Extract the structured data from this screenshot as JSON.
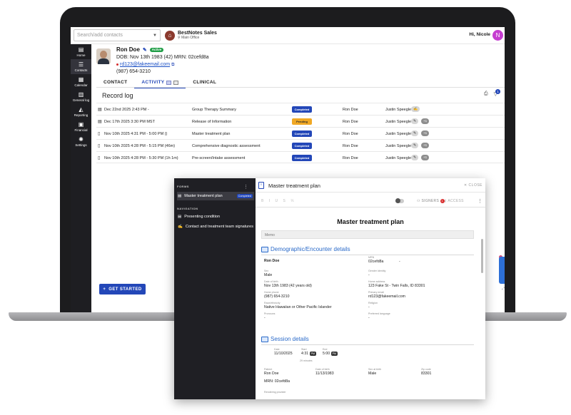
{
  "topbar": {
    "search_placeholder": "Search/add contacts",
    "org_name": "BestNotes Sales",
    "org_location": "Main Office",
    "greeting": "Hi, Nicole",
    "user_initial": "N"
  },
  "nav": {
    "items": [
      {
        "icon": "home-icon",
        "glyph": "▤",
        "label": "Home"
      },
      {
        "icon": "contacts-icon",
        "glyph": "☰",
        "label": "Contacts"
      },
      {
        "icon": "calendar-icon",
        "glyph": "▦",
        "label": "Calendar"
      },
      {
        "icon": "general-log-icon",
        "glyph": "▥",
        "label": "General log"
      },
      {
        "icon": "reporting-icon",
        "glyph": "◭",
        "label": "Reporting"
      },
      {
        "icon": "financial-icon",
        "glyph": "▣",
        "label": "Financial"
      },
      {
        "icon": "settings-icon",
        "glyph": "✺",
        "label": "Settings"
      }
    ]
  },
  "contact": {
    "name": "Ron Doe",
    "status": "Active",
    "dob_line": "DOB: Nov 13th 1983 (42)  MRN: 02cefd8a",
    "email": "rd123@fakeemail.com",
    "phone": "(987) 654-3210"
  },
  "tabs": [
    "CONTACT",
    "ACTIVITY",
    "CLINICAL"
  ],
  "record_log": {
    "title": "Record log",
    "filter_count": "1",
    "rows": [
      {
        "date": "Dec 22nd 2025 2:43 PM -",
        "title": "Group Therapy Summary",
        "status": "Completed",
        "client": "Ron Doe",
        "staff": "Justin Speegle",
        "chip2": ""
      },
      {
        "date": "Dec 17th 2025 3:30 PM MST",
        "title": "Release of Information",
        "status": "Pending",
        "client": "Ron Doe",
        "staff": "Justin Speegle",
        "chip2": "+1"
      },
      {
        "date": "Nov 10th 2025 4:31 PM - 5:00 PM ()",
        "title": "Master treatment plan",
        "status": "Completed",
        "client": "Ron Doe",
        "staff": "Justin Speegle",
        "chip2": "+1"
      },
      {
        "date": "Nov 10th 2025 4:28 PM - 5:15 PM (46m)",
        "title": "Comprehensive diagnostic assessment",
        "status": "Completed",
        "client": "Ron Doe",
        "staff": "Justin Speegle",
        "chip2": "+1"
      },
      {
        "date": "Nov 10th 2025 4:28 PM - 5:30 PM (1h 1m)",
        "title": "Pre-screen/Intake assessment",
        "status": "Completed",
        "client": "Ron Doe",
        "staff": "Justin Speegle",
        "chip2": "+1"
      }
    ]
  },
  "get_started": "GET STARTED",
  "popup": {
    "forms_header": "FORMS",
    "form_item": "Master treatment plan",
    "form_status": "Completed",
    "navigation_header": "NAVIGATION",
    "nav_items": [
      "Presenting condition",
      "Contact and treatment team signatures"
    ],
    "title": "Master treatment plan",
    "close": "CLOSE",
    "format_tools": "B I U S ⅓",
    "signers": "SIGNERS",
    "signers_count": "1",
    "access": "ACCESS",
    "doc_title": "Master treatment plan",
    "memo": "Memo",
    "demo_section": "Demographic/Encounter details",
    "demo": {
      "name": "Ron Doe",
      "mrn_label": "MRN",
      "mrn": "02cefd8a",
      "mrn_extra": "-",
      "sex_label": "Sex",
      "sex": "Male",
      "gender_label": "Gender identity",
      "gender": "-",
      "dob_label": "Date of birth",
      "dob": "Nov 13th 1983 (42 years old)",
      "address_label": "Home address",
      "address": "123 Fake St - Twin Falls, ID 83301",
      "phone_label": "Home phone",
      "phone": "(987) 654-3210",
      "email_label": "Primary email",
      "email": "rd123@fakeemail.com",
      "race_label": "Race/ethnicity",
      "race": "Native Hawaiian or Other Pacific Islander",
      "religion_label": "Religion",
      "religion": "-",
      "pronouns_label": "Pronouns",
      "pronouns": "-",
      "language_label": "Preferred language",
      "language": "-"
    },
    "session_section": "Session details",
    "session": {
      "date_label": "Date",
      "date": "11/10/2025",
      "start_label": "Start",
      "start": "4:31",
      "start_ampm": "PM",
      "end_label": "End",
      "end": "5:00",
      "end_ampm": "PM",
      "duration": "29 minutes",
      "patient_label": "Patient",
      "patient": "Ron Doe",
      "patient_mrn": "MRN: 02cefd8a",
      "dob_label": "Date of birth",
      "dob": "11/13/1983",
      "sex_label": "Sex at birth",
      "sex": "Male",
      "zip_label": "Zip code",
      "zip": "83301",
      "provider_label": "Rendering provider"
    }
  }
}
